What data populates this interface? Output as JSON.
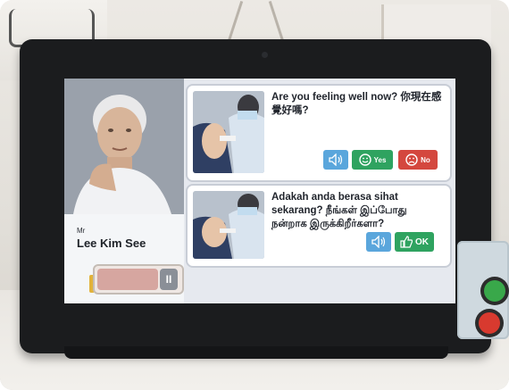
{
  "device": {
    "profile": {
      "title": "Mr",
      "name": "Lee Kim See"
    },
    "cards": [
      {
        "question": "Are you feeling well now? 你現在感覺好嗎?",
        "buttons": [
          {
            "icon": "speaker-icon"
          },
          {
            "icon": "smile-icon",
            "label": "Yes"
          },
          {
            "icon": "frown-icon",
            "label": "No"
          }
        ]
      },
      {
        "question": "Adakah anda berasa sihat sekarang? நீங்கள் இப்போது நன்றாக இருக்கிறீர்களா?",
        "buttons": [
          {
            "icon": "speaker-icon"
          },
          {
            "icon": "thumbs-up-icon",
            "label": "OK"
          }
        ]
      }
    ],
    "slider": {
      "handle_glyph": "II",
      "fill_fraction": 0.72
    }
  },
  "colors": {
    "yes": "#2fa360",
    "no": "#d4473e",
    "audio": "#5aa6dc"
  }
}
